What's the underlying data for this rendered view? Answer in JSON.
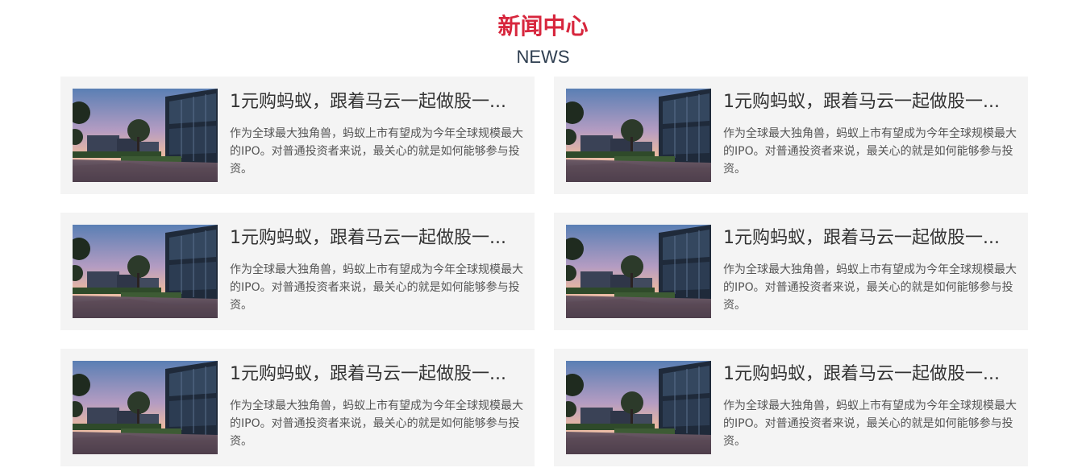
{
  "header": {
    "title": "新闻中心",
    "subtitle": "NEWS"
  },
  "news": [
    {
      "title": "1元购蚂蚁，跟着马云一起做股一...",
      "desc": "作为全球最大独角兽，蚂蚁上市有望成为今年全球规模最大的IPO。对普通投资者来说，最关心的就是如何能够参与投资。"
    },
    {
      "title": "1元购蚂蚁，跟着马云一起做股一...",
      "desc": "作为全球最大独角兽，蚂蚁上市有望成为今年全球规模最大的IPO。对普通投资者来说，最关心的就是如何能够参与投资。"
    },
    {
      "title": "1元购蚂蚁，跟着马云一起做股一...",
      "desc": "作为全球最大独角兽，蚂蚁上市有望成为今年全球规模最大的IPO。对普通投资者来说，最关心的就是如何能够参与投资。"
    },
    {
      "title": "1元购蚂蚁，跟着马云一起做股一...",
      "desc": "作为全球最大独角兽，蚂蚁上市有望成为今年全球规模最大的IPO。对普通投资者来说，最关心的就是如何能够参与投资。"
    },
    {
      "title": "1元购蚂蚁，跟着马云一起做股一...",
      "desc": "作为全球最大独角兽，蚂蚁上市有望成为今年全球规模最大的IPO。对普通投资者来说，最关心的就是如何能够参与投资。"
    },
    {
      "title": "1元购蚂蚁，跟着马云一起做股一...",
      "desc": "作为全球最大独角兽，蚂蚁上市有望成为今年全球规模最大的IPO。对普通投资者来说，最关心的就是如何能够参与投资。"
    }
  ],
  "colors": {
    "title_red": "#d7263d",
    "subtitle": "#2e3e50",
    "card_bg": "#f4f4f4"
  }
}
